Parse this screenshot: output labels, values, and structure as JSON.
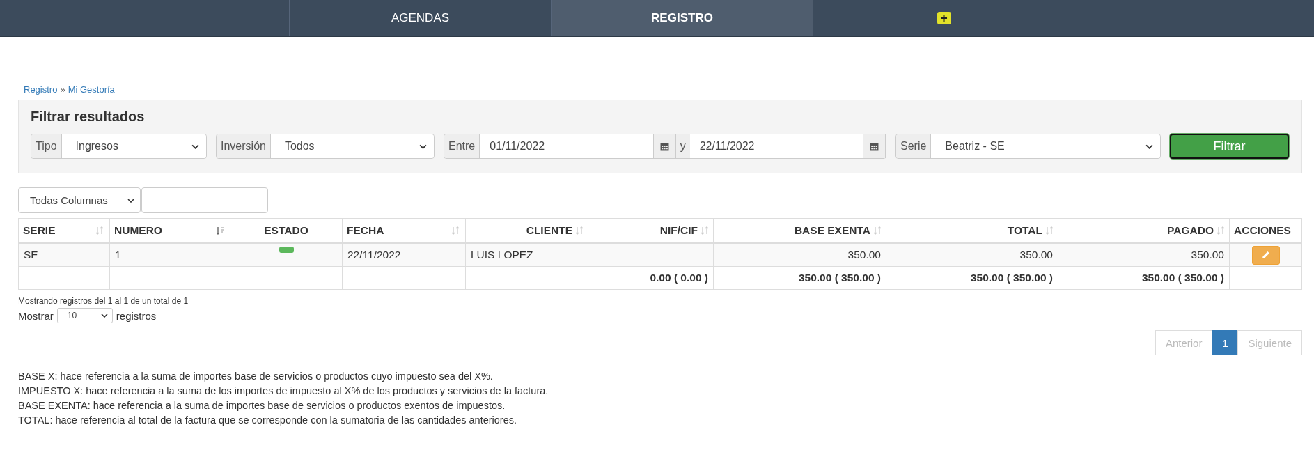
{
  "nav": {
    "tabs": [
      {
        "label": "AGENDAS",
        "kind": "text",
        "selected": false
      },
      {
        "label": "REGISTRO",
        "kind": "text",
        "selected": true
      },
      {
        "label": "+",
        "kind": "add",
        "selected": false
      }
    ]
  },
  "breadcrumb": {
    "items": [
      "Registro",
      "Mi Gestoría"
    ],
    "separator": "»"
  },
  "filters": {
    "title": "Filtrar resultados",
    "groups": [
      {
        "kind": "select",
        "label": "Tipo",
        "value": "Ingresos"
      },
      {
        "kind": "select",
        "label": "Inversión",
        "value": "Todos"
      },
      {
        "kind": "daterange",
        "label": "Entre",
        "from": "01/11/2022",
        "joiner": "y",
        "to": "22/11/2022"
      },
      {
        "kind": "select",
        "label": "Serie",
        "value": "Beatriz - SE"
      }
    ],
    "button": "Filtrar"
  },
  "column_filter": {
    "value": "Todas Columnas"
  },
  "table": {
    "columns": [
      {
        "label": "SERIE",
        "kind": "sortable"
      },
      {
        "label": "NUMERO",
        "kind": "sorted"
      },
      {
        "label": "ESTADO",
        "kind": "plain"
      },
      {
        "label": "FECHA",
        "kind": "sortable"
      },
      {
        "label": "CLIENTE",
        "kind": "sortable"
      },
      {
        "label": "NIF/CIF",
        "kind": "sortable"
      },
      {
        "label": "BASE EXENTA",
        "kind": "sortable"
      },
      {
        "label": "TOTAL",
        "kind": "sortable"
      },
      {
        "label": "PAGADO",
        "kind": "sortable"
      },
      {
        "label": "ACCIONES",
        "kind": "plain"
      }
    ],
    "rows": [
      {
        "serie": "SE",
        "numero": "1",
        "estado": {
          "color": "#5cb85c"
        },
        "fecha": "22/11/2022",
        "cliente": "LUIS LOPEZ",
        "nif": "",
        "base_exenta": "350.00",
        "total": "350.00",
        "pagado": "350.00"
      }
    ],
    "totals": {
      "nif": "0.00 ( 0.00 )",
      "base_exenta": "350.00 ( 350.00 )",
      "total": "350.00 ( 350.00 )",
      "pagado": "350.00 ( 350.00 )"
    }
  },
  "info": "Mostrando registros del 1 al 1 de un total de 1",
  "length": {
    "before": "Mostrar",
    "value": "10",
    "after": "registros"
  },
  "pagination": [
    {
      "label": "Anterior",
      "kind": "nav",
      "disabled": true,
      "selected": false
    },
    {
      "label": "1",
      "kind": "page",
      "disabled": false,
      "selected": true
    },
    {
      "label": "Siguiente",
      "kind": "nav",
      "disabled": true,
      "selected": false
    }
  ],
  "notes": [
    "BASE X: hace referencia a la suma de importes base de servicios o productos cuyo impuesto sea del X%.",
    "IMPUESTO X: hace referencia a la suma de los importes de impuesto al X% de los productos y servicios de la factura.",
    "BASE EXENTA: hace referencia a la suma de importes base de servicios o productos exentos de impuestos.",
    "TOTAL: hace referencia al total de la factura que se corresponde con la sumatoria de las cantidades anteriores."
  ]
}
